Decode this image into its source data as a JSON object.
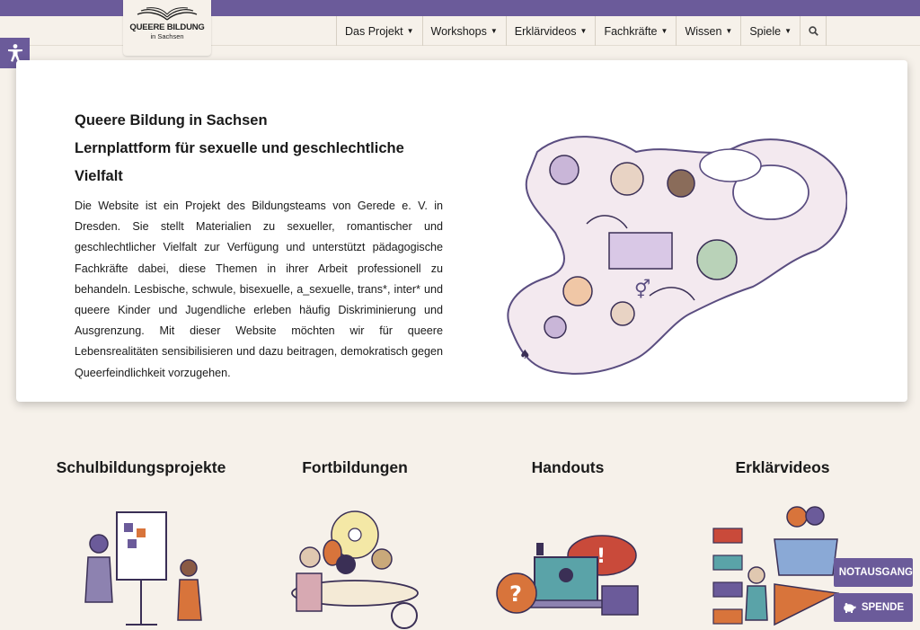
{
  "logo": {
    "line1": "QUEERE BILDUNG",
    "line2": "in Sachsen"
  },
  "nav": [
    {
      "label": "Das Projekt",
      "has_caret": true
    },
    {
      "label": "Workshops",
      "has_caret": true
    },
    {
      "label": "Erklärvideos",
      "has_caret": true
    },
    {
      "label": "Fachkräfte",
      "has_caret": true
    },
    {
      "label": "Wissen",
      "has_caret": true
    },
    {
      "label": "Spiele",
      "has_caret": true
    }
  ],
  "nav_search_icon": "search-icon",
  "accessibility_icon": "accessibility-icon",
  "hero": {
    "title_line1": "Queere Bildung in Sachsen",
    "title_line2": "Lernplattform für sexuelle und geschlechtliche Vielfalt",
    "intro": "Die Website ist ein Projekt des Bildungsteams von Gerede e. V. in Dresden. Sie stellt Materialien zu sexueller, romantischer und geschlechtlicher Vielfalt zur Verfügung und unterstützt pädagogische Fachkräfte dabei, diese Themen in ihrer Arbeit professionell zu behandeln. Lesbische, schwule, bisexuelle, a_sexuelle, trans*, inter* und queere Kinder und Jugendliche erleben häufig Diskriminierung und Ausgrenzung. Mit dieser Website möchten wir für queere Lebensrealitäten sensibilisieren und dazu beitragen, demokratisch gegen Queerfeindlichkeit vorzugehen."
  },
  "sections": [
    {
      "title": "Schulbildungsprojekte"
    },
    {
      "title": "Fortbildungen"
    },
    {
      "title": "Handouts"
    },
    {
      "title": "Erklärvideos"
    }
  ],
  "buttons": {
    "notausgang": "NOTAUSGANG",
    "spende": "SPENDE"
  },
  "colors": {
    "brand_purple": "#6b5b9a",
    "background": "#f6f1ea",
    "card": "#ffffff"
  }
}
